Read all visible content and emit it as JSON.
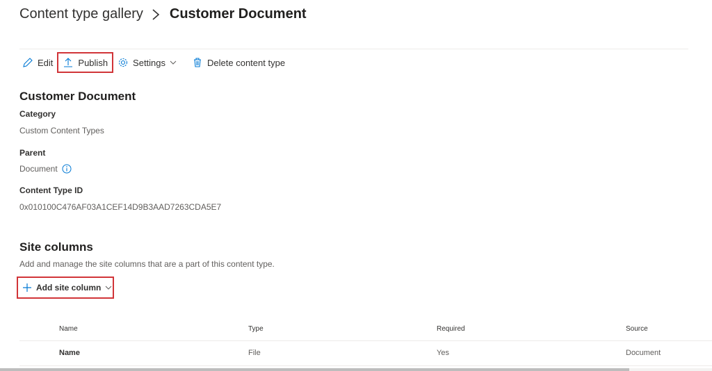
{
  "breadcrumb": {
    "parent": "Content type gallery",
    "current": "Customer Document"
  },
  "commandbar": {
    "edit": "Edit",
    "publish": "Publish",
    "settings": "Settings",
    "delete": "Delete content type"
  },
  "details": {
    "title": "Customer Document",
    "category_label": "Category",
    "category_value": "Custom Content Types",
    "parent_label": "Parent",
    "parent_value": "Document",
    "id_label": "Content Type ID",
    "id_value": "0x010100C476AF03A1CEF14D9B3AAD7263CDA5E7"
  },
  "site_columns": {
    "title": "Site columns",
    "description": "Add and manage the site columns that are a part of this content type.",
    "add_button": "Add site column",
    "headers": [
      "Name",
      "Type",
      "Required",
      "Source"
    ],
    "rows": [
      {
        "name": "Name",
        "type": "File",
        "required": "Yes",
        "source": "Document"
      }
    ]
  },
  "colors": {
    "accent": "#0078d4",
    "highlight": "#d13438"
  }
}
